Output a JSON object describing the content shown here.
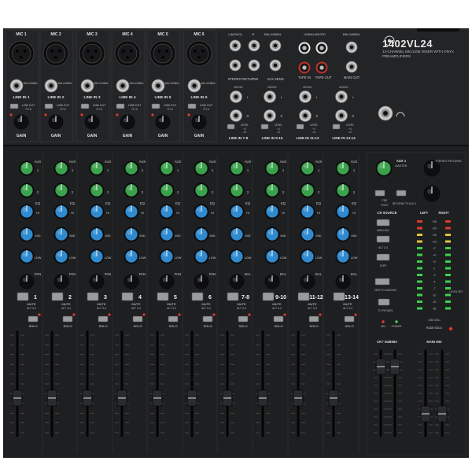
{
  "brand": {
    "model": "1402VL24",
    "description": "14-CHANNEL MIC/LINE MIXER WITH ONYX PREAMPLIFIERS"
  },
  "mic_channels": [
    {
      "mic_label": "MIC 1",
      "line_label": "LINE IN 1"
    },
    {
      "mic_label": "MIC 2",
      "line_label": "LINE IN 2"
    },
    {
      "mic_label": "MIC 3",
      "line_label": "LINE IN 3"
    },
    {
      "mic_label": "MIC 4",
      "line_label": "LINE IN 4"
    },
    {
      "mic_label": "MIC 5",
      "line_label": "LINE IN 5"
    },
    {
      "mic_label": "MIC 6",
      "line_label": "LINE IN 6"
    }
  ],
  "mic_strip_labels": {
    "bal": "BAL/UNBAL",
    "low_cut": "LOW CUT",
    "low_cut_freq": "75 Hz",
    "gain": "GAIN"
  },
  "rear_sections": {
    "l_mono": "L(MONO)",
    "r": "R",
    "bal_unbal": "BAL/UNBAL",
    "unbalanced": "UNBALANCED",
    "stereo_returns": "STEREO RETURNS",
    "aux_send": "AUX SEND",
    "tape_in": "TAPE IN",
    "tape_out": "TAPE OUT",
    "main_out": "MAIN OUT",
    "mono": "MONO",
    "l": "L",
    "level": "LEVEL",
    "plus4": "+4",
    "minus10": "-10",
    "line_inputs": [
      "LINE IN 7-8",
      "LINE IN 9-10",
      "LINE IN 11-12",
      "LINE IN 13-14"
    ]
  },
  "strip_labels": {
    "aux": "AUX",
    "aux1": "1",
    "aux2": "2",
    "eq": "EQ",
    "hi": "HI",
    "mid": "MID",
    "low": "LOW",
    "pan": "PAN",
    "bal": "BAL",
    "mute": "MUTE",
    "alt34": "ALT 3-4",
    "solo": "SOLO"
  },
  "channels": [
    {
      "number": "1",
      "pan_label": "PAN"
    },
    {
      "number": "2",
      "pan_label": "PAN"
    },
    {
      "number": "3",
      "pan_label": "PAN"
    },
    {
      "number": "4",
      "pan_label": "PAN"
    },
    {
      "number": "5",
      "pan_label": "PAN"
    },
    {
      "number": "6",
      "pan_label": "PAN"
    },
    {
      "number": "7-8",
      "pan_label": "BAL"
    },
    {
      "number": "9-10",
      "pan_label": "BAL"
    },
    {
      "number": "11-12",
      "pan_label": "BAL"
    },
    {
      "number": "13-14",
      "pan_label": "BAL"
    }
  ],
  "master": {
    "aux1": "AUX 1",
    "master_label": "MASTER",
    "stereo_returns": "STEREO RETURNS",
    "pre": "PRE",
    "post": "POST",
    "returns_to_aux1": "RETURNS TO AUX 1",
    "cr_source": "CR SOURCE",
    "main_mix": "MAIN MIX",
    "alt34": "ALT 3-4",
    "tape": "TAPE",
    "to_main": "TAPE TO MAIN MIX",
    "to_phones": "TO PHONES",
    "level_set": "LEVEL SET",
    "rude_solo": "RUDE SOLO",
    "power": "POWER",
    "phantom": "48V",
    "left": "LEFT",
    "right": "RIGHT",
    "cr_submix": "CR / SUBMIX",
    "main_mix_fader": "MAIN MIX",
    "solo_label": "SOLO",
    "meter_labels": [
      "+28",
      "+20",
      "+15",
      "+10",
      "+7",
      "+4",
      "+2",
      "0",
      "-2",
      "-4",
      "-7",
      "-10",
      "-20",
      "-30"
    ],
    "meter_bottom": "0dB=0dBu"
  },
  "colors": {
    "panel": "#232426",
    "knob_green": "#3aa24c",
    "knob_blue": "#2f8ad0",
    "knob_black": "#0d0e10",
    "led_green": "#3fcf4f",
    "led_red": "#e23a2e",
    "text": "#d8d8d8"
  }
}
